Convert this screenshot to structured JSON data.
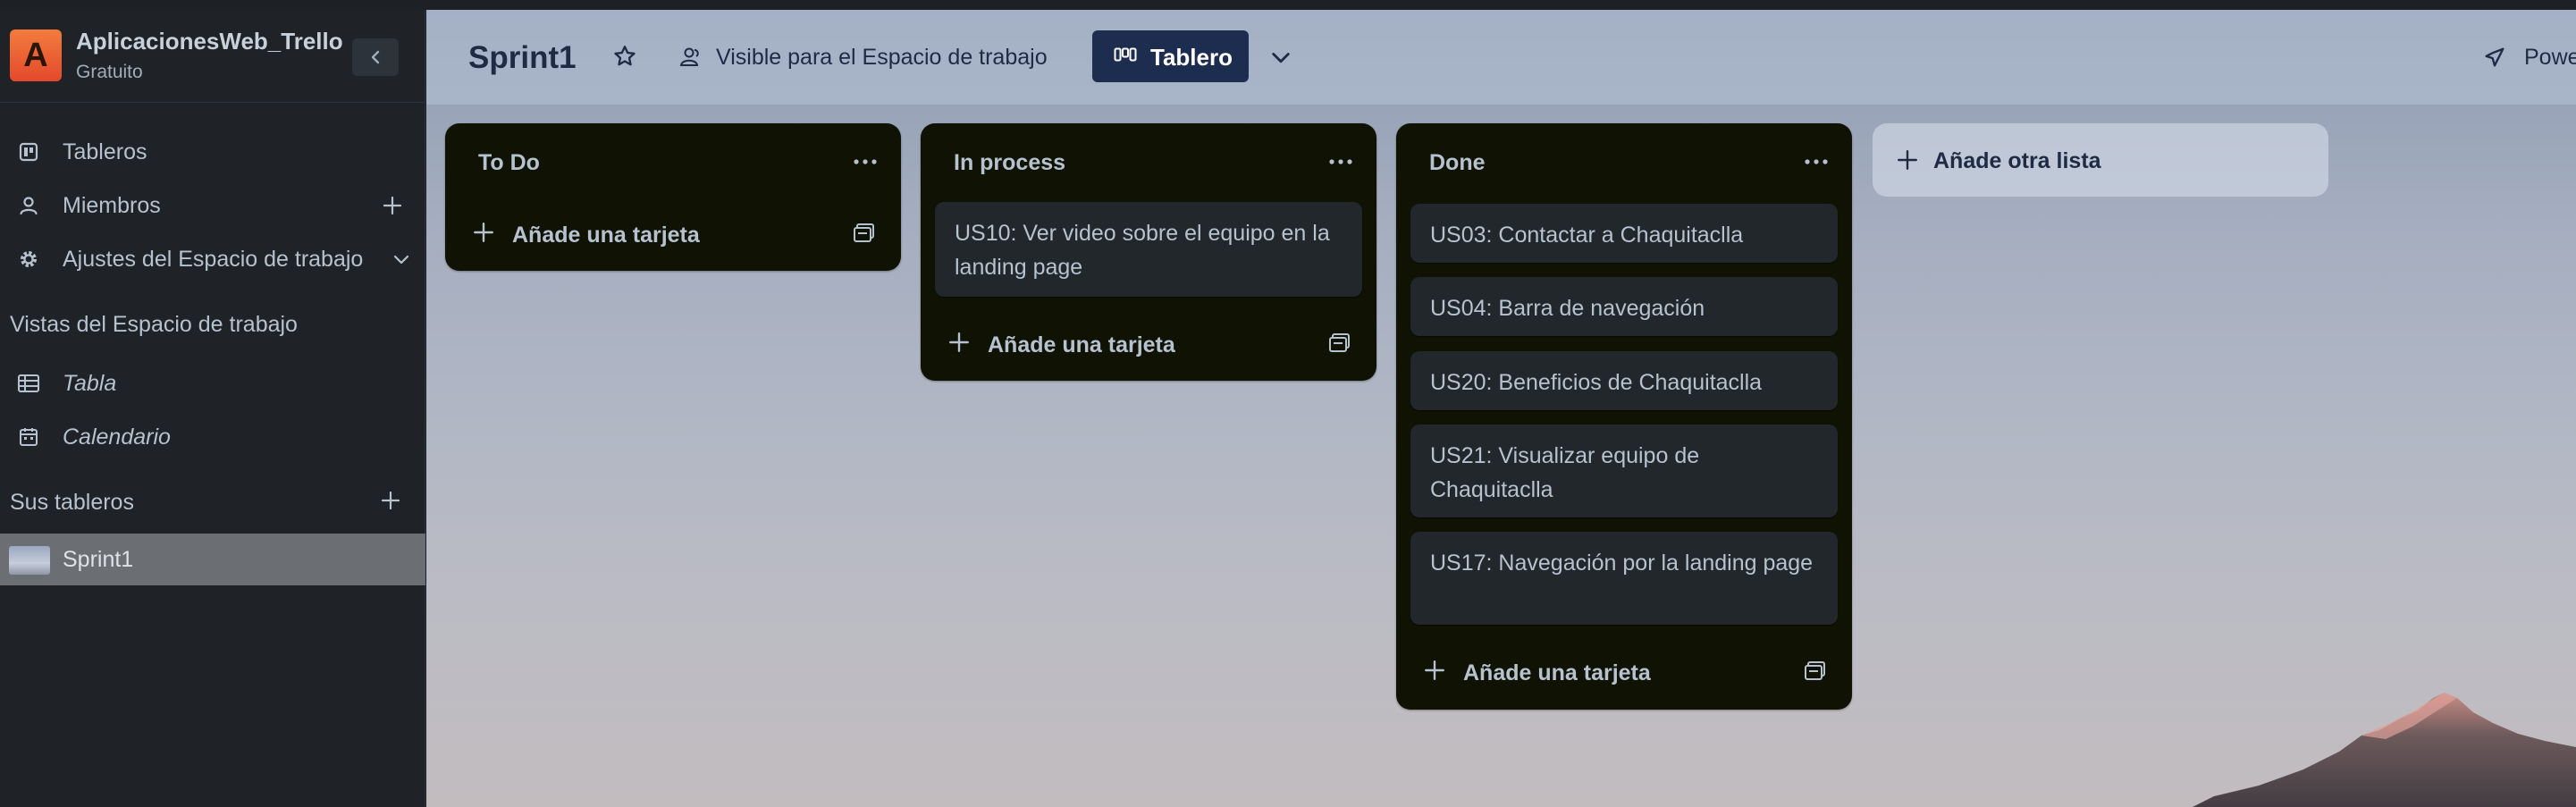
{
  "workspace": {
    "logo_letter": "A",
    "name": "AplicacionesWeb_Trello",
    "plan": "Gratuito"
  },
  "sidebar": {
    "items": [
      {
        "label": "Tableros"
      },
      {
        "label": "Miembros"
      },
      {
        "label": "Ajustes del Espacio de trabajo"
      }
    ],
    "views_title": "Vistas del Espacio de trabajo",
    "views": [
      {
        "label": "Tabla"
      },
      {
        "label": "Calendario"
      }
    ],
    "boards_title": "Sus tableros",
    "boards": [
      {
        "label": "Sprint1"
      }
    ]
  },
  "board": {
    "title": "Sprint1",
    "visibility": "Visible para el Espacio de trabajo",
    "view_label": "Tablero",
    "power_ups_label": "Powe",
    "add_list_label": "Añade otra lista",
    "add_card_label": "Añade una tarjeta",
    "lists": [
      {
        "title": "To Do",
        "cards": []
      },
      {
        "title": "In process",
        "cards": [
          "US10: Ver video sobre el equipo en la landing page"
        ]
      },
      {
        "title": "Done",
        "cards": [
          "US03: Contactar a Chaquitaclla",
          "US04: Barra de navegación",
          "US20: Beneficios de Chaquitaclla",
          "US21: Visualizar equipo de Chaquitaclla",
          "US17: Navegación por la landing page"
        ]
      }
    ]
  },
  "colors": {
    "sidebar_bg": "#1f2226",
    "list_bg": "#101204",
    "card_bg": "#22272b",
    "view_button_bg": "#1d2d50",
    "logo_gradient_top": "#f27c3e",
    "logo_gradient_bottom": "#e4492b"
  }
}
